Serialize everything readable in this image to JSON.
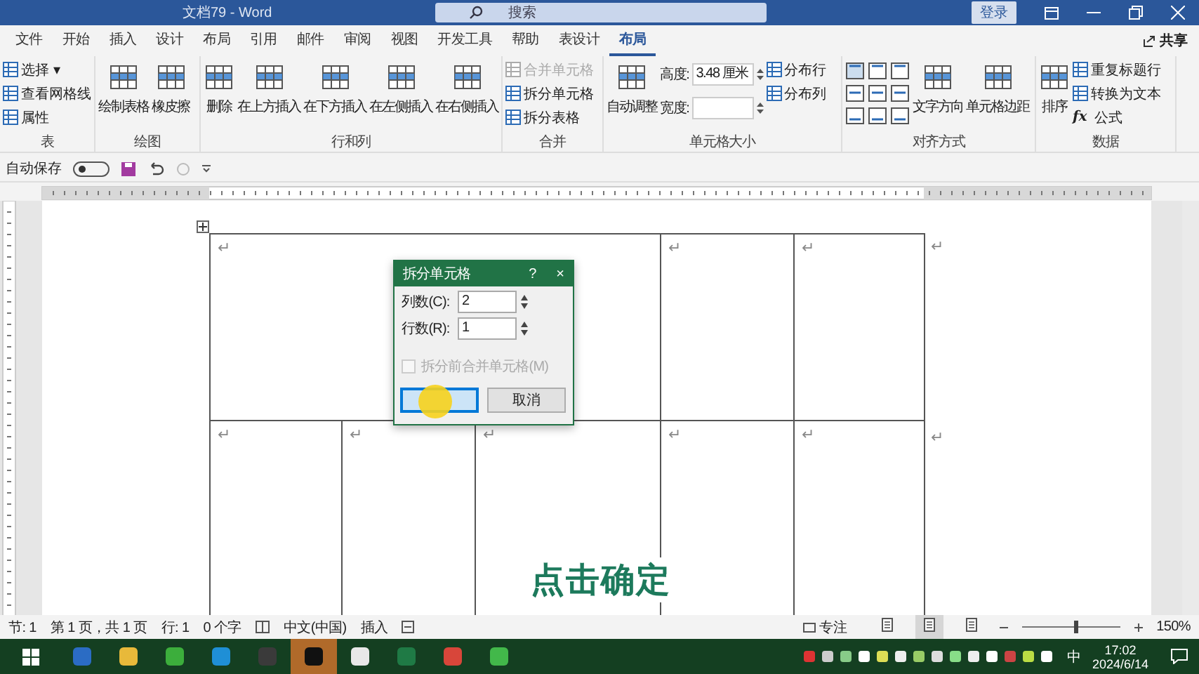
{
  "window": {
    "title": "文档79 - Word",
    "search_placeholder": "搜索",
    "sign_in": "登录"
  },
  "tabs": [
    {
      "label": "文件",
      "selected": false
    },
    {
      "label": "开始",
      "selected": false
    },
    {
      "label": "插入",
      "selected": false
    },
    {
      "label": "设计",
      "selected": false
    },
    {
      "label": "布局",
      "selected": false
    },
    {
      "label": "引用",
      "selected": false
    },
    {
      "label": "邮件",
      "selected": false
    },
    {
      "label": "审阅",
      "selected": false
    },
    {
      "label": "视图",
      "selected": false
    },
    {
      "label": "开发工具",
      "selected": false
    },
    {
      "label": "帮助",
      "selected": false
    },
    {
      "label": "表设计",
      "selected": false
    },
    {
      "label": "布局",
      "selected": true
    }
  ],
  "share": "共享",
  "ribbon": {
    "groups": [
      {
        "label": "表",
        "columns": [
          [
            {
              "kind": "small",
              "label": "选择 ▾"
            },
            {
              "kind": "small",
              "label": "查看网格线"
            },
            {
              "kind": "small",
              "label": "属性"
            }
          ]
        ]
      },
      {
        "label": "绘图",
        "columns": [
          [
            {
              "kind": "large",
              "label": "绘制表格"
            }
          ],
          [
            {
              "kind": "large",
              "label": "橡皮擦"
            }
          ]
        ]
      },
      {
        "label": "行和列",
        "columns": [
          [
            {
              "kind": "large",
              "label": "删除"
            }
          ],
          [
            {
              "kind": "large",
              "label": "在上方插入"
            }
          ],
          [
            {
              "kind": "large",
              "label": "在下方插入"
            }
          ],
          [
            {
              "kind": "large",
              "label": "在左侧插入"
            }
          ],
          [
            {
              "kind": "large",
              "label": "在右侧插入"
            }
          ]
        ]
      },
      {
        "label": "合并",
        "columns": [
          [
            {
              "kind": "small",
              "label": "合并单元格",
              "disabled": true
            },
            {
              "kind": "small",
              "label": "拆分单元格",
              "disabled": false
            },
            {
              "kind": "small",
              "label": "拆分表格",
              "disabled": false
            }
          ]
        ]
      },
      {
        "label": "单元格大小",
        "columns": [
          [
            {
              "kind": "large",
              "label": "自动调整"
            }
          ],
          [
            {
              "kind": "field",
              "label": "高度:",
              "value": "3.48 厘米"
            },
            {
              "kind": "field",
              "label": "宽度:"
            }
          ],
          [
            {
              "kind": "small",
              "label": "分布行"
            },
            {
              "kind": "small",
              "label": "分布列"
            }
          ]
        ]
      },
      {
        "label": "对齐方式",
        "columns": [
          [
            {
              "kind": "align"
            }
          ],
          [
            {
              "kind": "large",
              "label": "文字方向"
            }
          ],
          [
            {
              "kind": "large",
              "label": "单元格边距"
            }
          ]
        ]
      },
      {
        "label": "数据",
        "columns": [
          [
            {
              "kind": "large",
              "label": "排序"
            }
          ],
          [
            {
              "kind": "small",
              "label": "重复标题行"
            },
            {
              "kind": "small",
              "label": "转换为文本"
            },
            {
              "kind": "formula",
              "label": "公式",
              "icon_text": "fx"
            }
          ]
        ]
      }
    ],
    "align_cells": [
      {
        "selected": true
      },
      {
        "selected": false
      },
      {
        "selected": false
      },
      {
        "selected": false
      },
      {
        "selected": false
      },
      {
        "selected": false
      },
      {
        "selected": false
      },
      {
        "selected": false
      },
      {
        "selected": false
      }
    ]
  },
  "quick_access": {
    "autosave_label": "自动保存",
    "autosave_on": false
  },
  "table": {
    "rows": [
      {
        "cells": [
          {
            "text": "↵",
            "colspan": 3
          },
          {
            "text": "↵"
          },
          {
            "text": "↵"
          }
        ],
        "end_mark": "↵"
      },
      {
        "cells": [
          {
            "text": "↵"
          },
          {
            "text": "↵"
          },
          {
            "text": "↵"
          },
          {
            "text": "↵"
          },
          {
            "text": "↵"
          }
        ],
        "end_mark": "↵"
      }
    ]
  },
  "dialog": {
    "title": "拆分单元格",
    "help": "?",
    "close": "×",
    "fields": [
      {
        "label": "列数(C):",
        "value": "2"
      },
      {
        "label": "行数(R):",
        "value": "1"
      }
    ],
    "checkbox": {
      "label": "拆分前合并单元格(M)",
      "checked": false,
      "disabled": true
    },
    "ok_button": {
      "focused": true
    },
    "cancel_button": {
      "label": "取消"
    }
  },
  "caption": "点击确定",
  "status_bar": {
    "left": [
      "节: 1",
      "第 1 页，共 1 页",
      "行: 1",
      "0 个字"
    ],
    "language": "中文(中国)",
    "mode": "插入",
    "focus": "专注",
    "views": [
      {
        "selected": false
      },
      {
        "selected": true
      },
      {
        "selected": false
      }
    ],
    "zoom": {
      "level": 0.55
    },
    "zoom_text": "150%"
  },
  "taskbar": {
    "apps": [
      {
        "color": "#2b6cc4",
        "selected": false
      },
      {
        "color": "#e8b93a",
        "selected": false
      },
      {
        "color": "#3cae3c",
        "selected": false
      },
      {
        "color": "#1f8fd6",
        "selected": false
      },
      {
        "color": "#3a3a3a",
        "selected": false
      },
      {
        "color": "#111111",
        "selected": true
      },
      {
        "color": "#e8e8e8",
        "selected": false
      },
      {
        "color": "#1f7a45",
        "selected": false
      },
      {
        "color": "#d8463a",
        "selected": false
      },
      {
        "color": "#42b84a",
        "selected": false
      }
    ],
    "ime": "中",
    "time": "17:02",
    "date": "2024/6/14"
  }
}
